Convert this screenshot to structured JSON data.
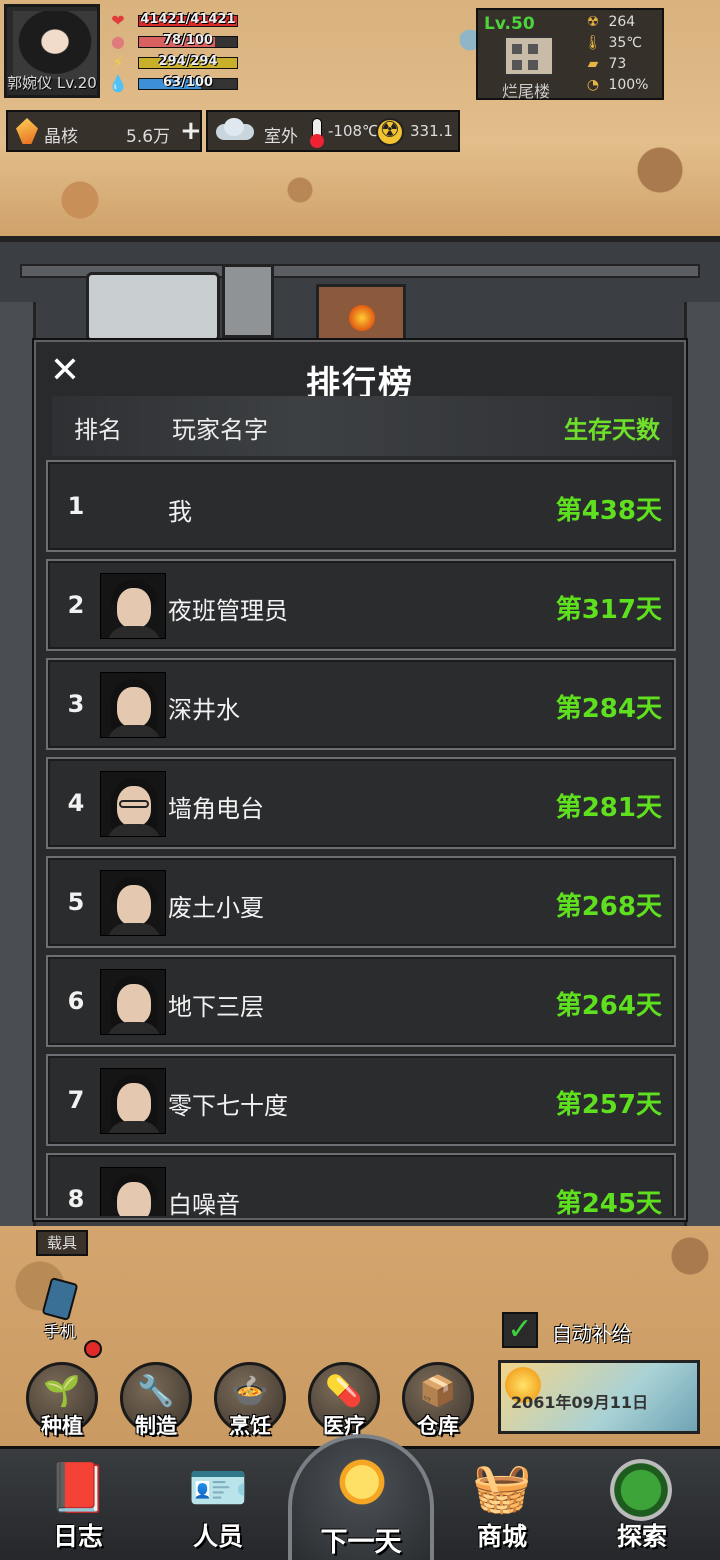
{
  "player": {
    "name": "郭婉仪 Lv.20",
    "stats": [
      {
        "icon": "heart-icon",
        "text": "41421/41421",
        "fill": 1.0,
        "color": "#d92b2b"
      },
      {
        "icon": "stomach-icon",
        "text": "78/100",
        "fill": 0.78,
        "color": "#d96060"
      },
      {
        "icon": "energy-icon",
        "text": "294/294",
        "fill": 1.0,
        "color": "#c9b02a"
      },
      {
        "icon": "water-icon",
        "text": "63/100",
        "fill": 0.63,
        "color": "#3d8fd6"
      }
    ]
  },
  "resources": {
    "crystal_label": "晶核",
    "crystal_value": "5.6万",
    "location": "室外",
    "temperature": "-108℃",
    "radiation": "331.1"
  },
  "shelter": {
    "level": "Lv.50",
    "name": "烂尾楼",
    "radiation": "264",
    "temperature": "35℃",
    "supplies": "73",
    "integrity": "100%"
  },
  "leaderboard": {
    "title": "排行榜",
    "col_rank": "排名",
    "col_name": "玩家名字",
    "col_days": "生存天数",
    "rows": [
      {
        "rank": "1",
        "name": "我",
        "days": "第438天",
        "avatar": "none"
      },
      {
        "rank": "2",
        "name": "夜班管理员",
        "days": "第317天",
        "avatar": "male"
      },
      {
        "rank": "3",
        "name": "深井水",
        "days": "第284天",
        "avatar": "female"
      },
      {
        "rank": "4",
        "name": "墙角电台",
        "days": "第281天",
        "avatar": "glasses"
      },
      {
        "rank": "5",
        "name": "废土小夏",
        "days": "第268天",
        "avatar": "male"
      },
      {
        "rank": "6",
        "name": "地下三层",
        "days": "第264天",
        "avatar": "female"
      },
      {
        "rank": "7",
        "name": "零下七十度",
        "days": "第257天",
        "avatar": "female"
      },
      {
        "rank": "8",
        "name": "白噪音",
        "days": "第245天",
        "avatar": "male"
      }
    ]
  },
  "hud": {
    "vehicle": "载具",
    "phone": "手机",
    "auto_supply": "自动补给",
    "date": "2061年09月11日"
  },
  "actions": [
    {
      "label": "种植",
      "icon": "sprout-icon",
      "glyph": "🌱"
    },
    {
      "label": "制造",
      "icon": "tools-icon",
      "glyph": "🔧"
    },
    {
      "label": "烹饪",
      "icon": "pot-icon",
      "glyph": "🍲"
    },
    {
      "label": "医疗",
      "icon": "medkit-icon",
      "glyph": "💊"
    },
    {
      "label": "仓库",
      "icon": "crate-icon",
      "glyph": "📦"
    }
  ],
  "nav": {
    "log": "日志",
    "people": "人员",
    "next_day": "下一天",
    "shop": "商城",
    "explore": "探索"
  }
}
